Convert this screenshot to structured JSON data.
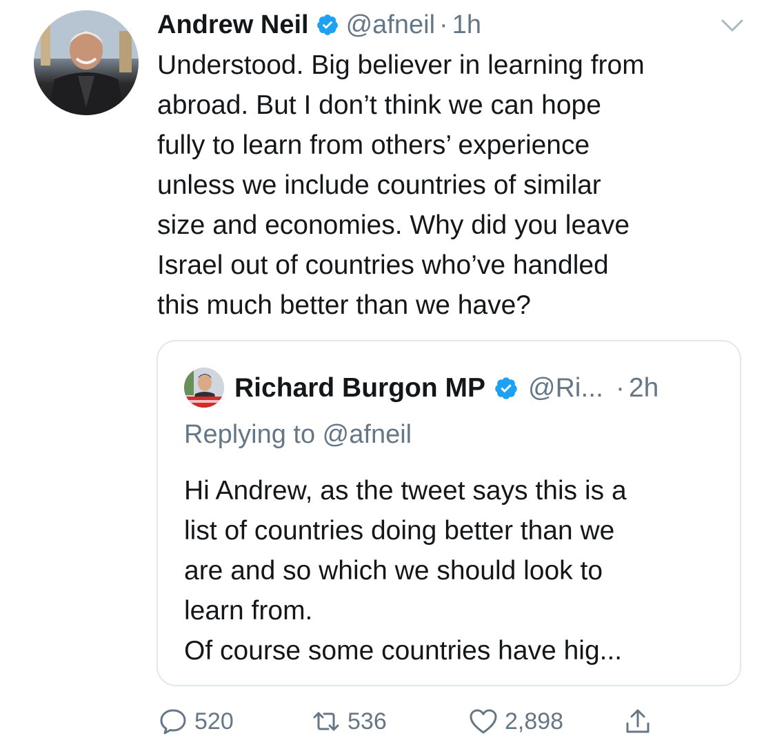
{
  "tweet": {
    "author_name": "Andrew Neil",
    "handle": "@afneil",
    "separator": "·",
    "time": "1h",
    "lines": [
      "Understood. Big believer in learning from",
      "abroad. But I don’t think we can hope",
      "fully to learn from others’ experience",
      "unless we include countries of similar",
      "size and economies. Why did you leave",
      "Israel out of countries who’ve handled",
      "this much better than we have?"
    ],
    "avatar_icon": "profile-photo",
    "menu_icon": "chevron-down-icon",
    "verified_icon": "verified-badge-icon"
  },
  "quoted": {
    "author_name": "Richard Burgon MP",
    "handle": "@Ri...",
    "separator": "·",
    "time": "2h",
    "replying_prefix": "Replying to ",
    "replying_handle": "@afneil",
    "lines": [
      "Hi Andrew, as the tweet says this is a",
      "list of countries doing better than we",
      "are and so which we should look to",
      "learn from.",
      "Of course some countries have hig..."
    ]
  },
  "actions": {
    "replies": "520",
    "retweets": "536",
    "likes": "2,898"
  },
  "colors": {
    "text": "#14171a",
    "muted": "#657786",
    "verified": "#1da1f2",
    "border": "#e1e8ed"
  }
}
